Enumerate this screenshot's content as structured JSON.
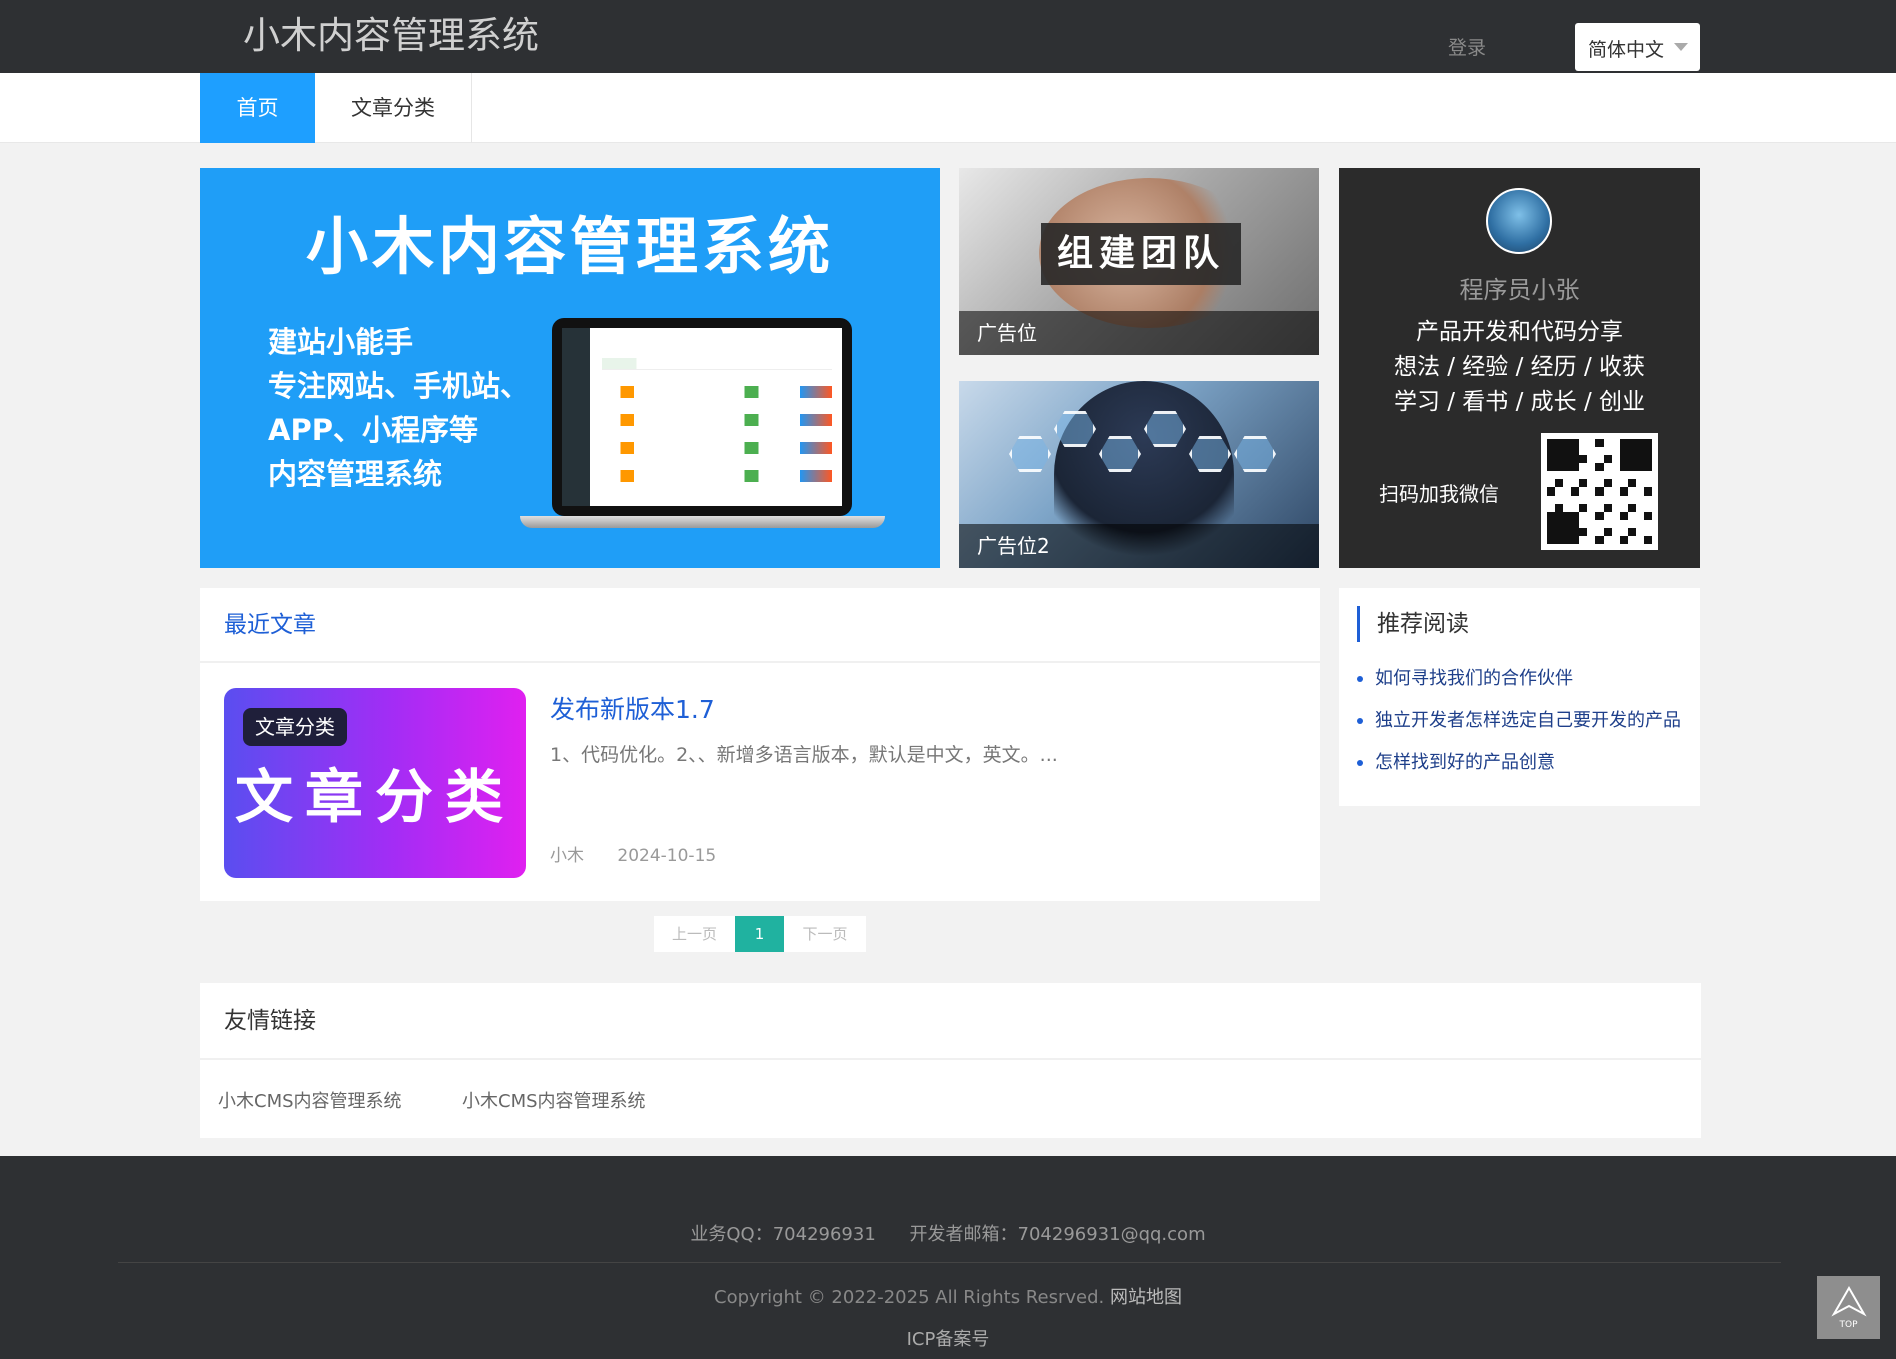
{
  "header": {
    "site_title": "小木内容管理系统",
    "login": "登录",
    "language": "简体中文"
  },
  "nav": {
    "home": "首页",
    "category": "文章分类"
  },
  "banner": {
    "title": "小木内容管理系统",
    "lines": [
      "建站小能手",
      "专注网站、手机站、",
      "APP、小程序等",
      "内容管理系统"
    ]
  },
  "ads": [
    {
      "badge": "组建团队",
      "caption": "广告位"
    },
    {
      "caption": "广告位2"
    }
  ],
  "profile": {
    "name": "程序员小张",
    "lines": [
      "产品开发和代码分享",
      "想法 / 经验 / 经历 / 收获",
      "学习 / 看书 / 成长 / 创业"
    ],
    "scan_text": "扫码加我微信"
  },
  "recent": {
    "heading": "最近文章",
    "article": {
      "thumb_tag": "文章分类",
      "thumb_big": "文章分类",
      "title": "发布新版本1.7",
      "desc": "1、代码优化。2、、新增多语言版本，默认是中文，英文。...",
      "author": "小木",
      "date": "2024-10-15"
    }
  },
  "pager": {
    "prev": "上一页",
    "current": "1",
    "next": "下一页"
  },
  "recommend": {
    "heading": "推荐阅读",
    "items": [
      "如何寻找我们的合作伙伴",
      "独立开发者怎样选定自己要开发的产品",
      "怎样找到好的产品创意"
    ]
  },
  "links": {
    "heading": "友情链接",
    "items": [
      "小木CMS内容管理系统",
      "小木CMS内容管理系统"
    ]
  },
  "footer": {
    "qq": "业务QQ：704296931",
    "email": "开发者邮箱：704296931@qq.com",
    "copyright": "Copyright © 2022-2025  All Rights Resrved.",
    "sitemap": "网站地图",
    "icp": "ICP备案号",
    "top_label": "TOP"
  },
  "colors": {
    "topbar": "#2e3033",
    "accent": "#1e9fff",
    "banner": "#1f9ef7",
    "pager_active": "#20b2a0",
    "link_blue": "#1e5fd6"
  }
}
